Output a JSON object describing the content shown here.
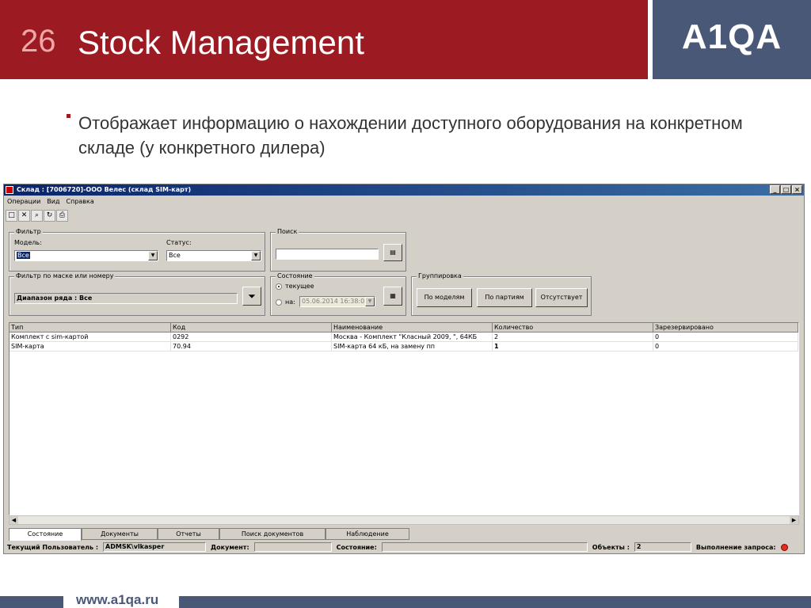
{
  "slide": {
    "number": "26",
    "title": "Stock Management",
    "logo": "A1QA",
    "bullet": "Отображает информацию о нахождении доступного оборудования на конкретном складе (у конкретного дилера)",
    "footer_url": "www.a1qa.ru"
  },
  "colors": {
    "header": "#9c1b22",
    "logo_bg": "#4a5878"
  },
  "window": {
    "title": "Склад : [7006720]-ООО Велес (склад SIM-карт)",
    "menu": [
      "Операции",
      "Вид",
      "Справка"
    ],
    "toolbar_icons": [
      "new-icon",
      "delete-icon",
      "find-icon",
      "refresh-icon",
      "print-icon"
    ],
    "filter": {
      "legend": "Фильтр",
      "model_label": "Модель:",
      "model_value": "Все",
      "status_label": "Статус:",
      "status_value": "Все"
    },
    "search": {
      "legend": "Поиск",
      "value": ""
    },
    "mask_filter": {
      "legend": "Фильтр по маске или номеру",
      "value": "Диапазон ряда : Все"
    },
    "state": {
      "legend": "Состояние",
      "current_label": "текущее",
      "at_label": "на:",
      "date": "05.06.2014 16:38:03"
    },
    "grouping": {
      "legend": "Группировка",
      "by_models": "По моделям",
      "by_batches": "По партиям",
      "absent": "Отсутствует"
    },
    "table": {
      "headers": [
        "Тип",
        "Код",
        "Наименование",
        "Количество",
        "Зарезервировано"
      ],
      "rows": [
        [
          "Комплект с sim-картой",
          "0292",
          "Москва - Комплект \"Класный 2009, \", 64КБ",
          "2",
          "0"
        ],
        [
          "SIM-карта",
          "70.94",
          "SIM-карта 64 кБ, на замену пп",
          "1",
          "0"
        ]
      ]
    },
    "tabs": [
      "Состояние",
      "Документы",
      "Отчеты",
      "Поиск документов",
      "Наблюдение"
    ],
    "statusbar": {
      "user_label": "Текущий Пользователь :",
      "user_value": "ADMSK\\vlkasper",
      "doc_label": "Документ:",
      "doc_value": "",
      "state_label": "Состояние:",
      "state_value": "",
      "objects_label": "Объекты :",
      "objects_value": "2",
      "query_label": "Выполнение запроса:"
    }
  }
}
